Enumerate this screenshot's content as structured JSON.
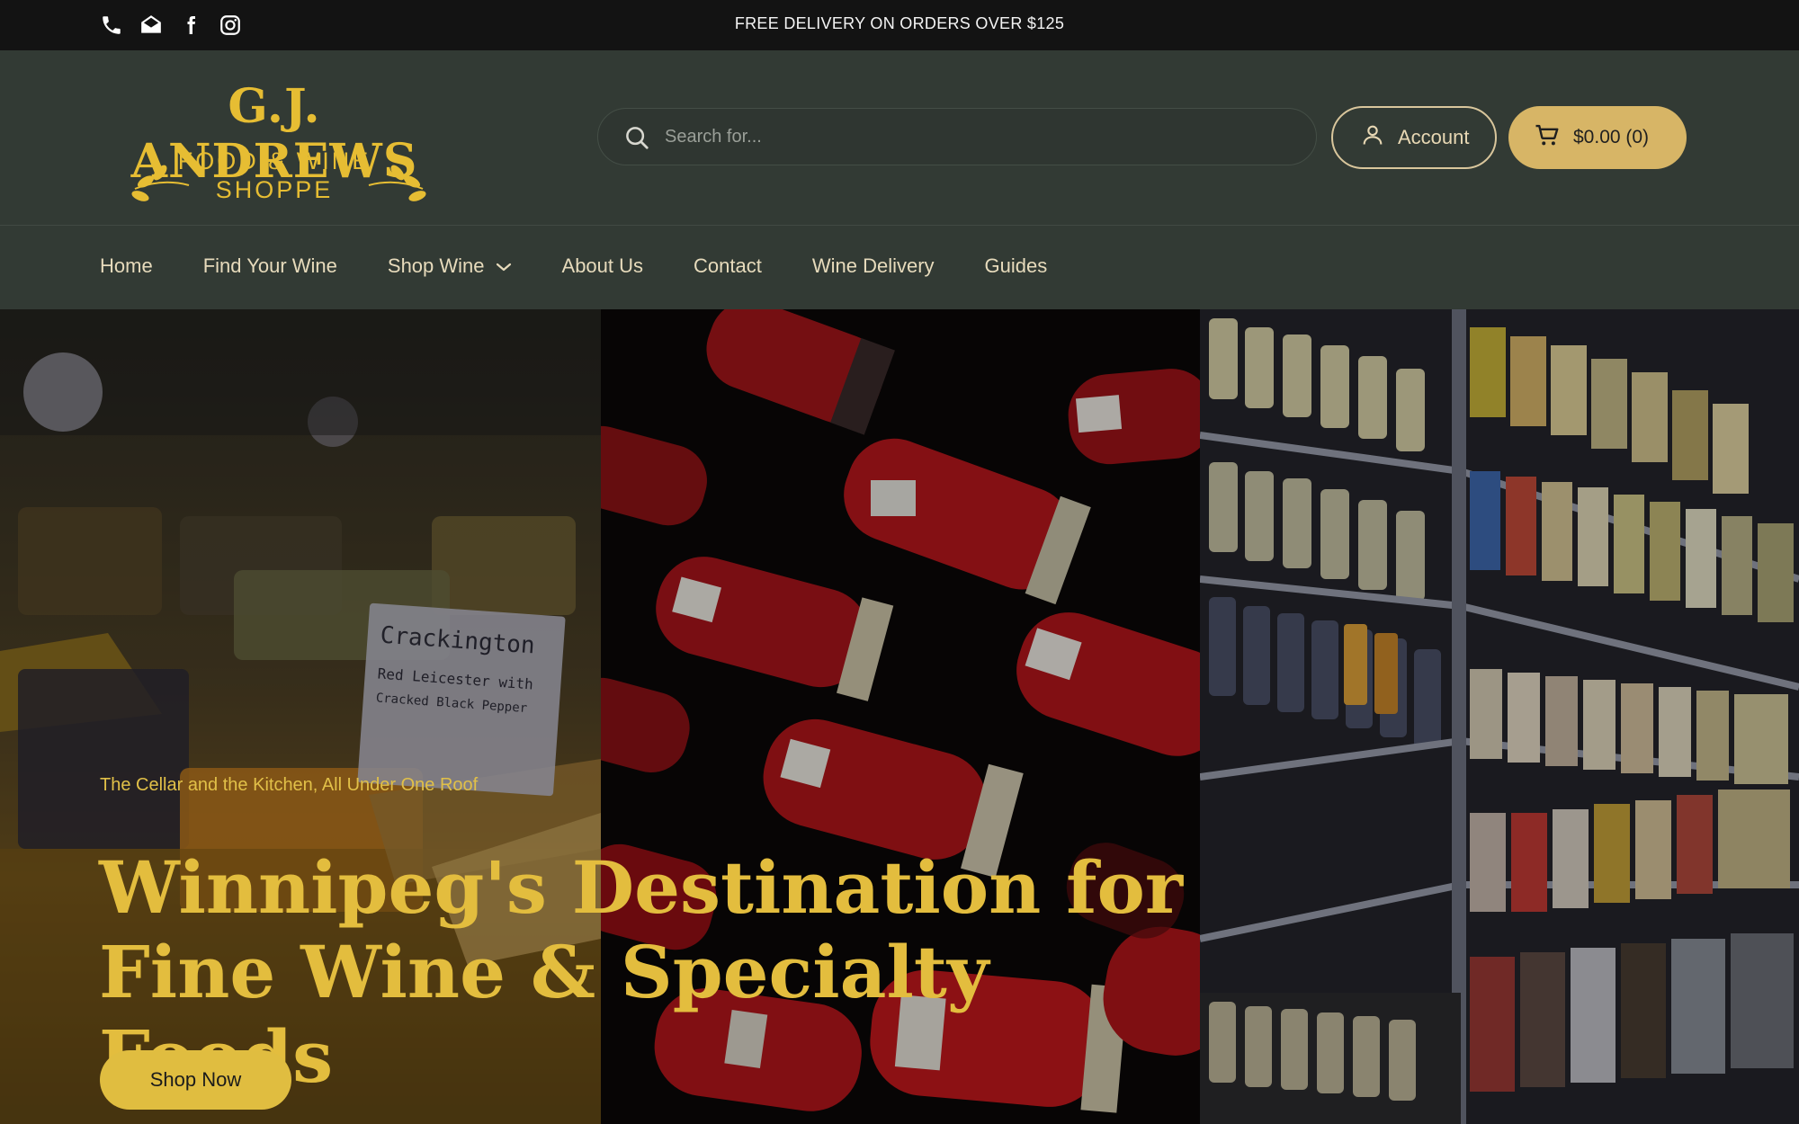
{
  "topbar": {
    "promo": "FREE DELIVERY ON ORDERS OVER $125",
    "social_icons": [
      "phone-icon",
      "email-icon",
      "facebook-icon",
      "instagram-icon"
    ]
  },
  "header": {
    "logo": {
      "brand": "G.J. ANDREWS",
      "line1": "FOOD & WINE",
      "line2": "SHOPPE"
    },
    "search": {
      "placeholder": "Search for..."
    },
    "account_label": "Account",
    "cart_label": "$0.00 (0)"
  },
  "nav": {
    "items": [
      {
        "label": "Home"
      },
      {
        "label": "Find Your Wine"
      },
      {
        "label": "Shop Wine"
      },
      {
        "label": "About Us"
      },
      {
        "label": "Contact"
      },
      {
        "label": "Wine Delivery"
      },
      {
        "label": "Guides"
      }
    ]
  },
  "hero": {
    "tagline": "The Cellar and the Kitchen, All Under One Roof",
    "headline": "Winnipeg's Destination for Fine Wine & Specialty Foods",
    "button_label": "Shop Now",
    "cheese_card": {
      "line1": "Crackington",
      "line2": "Red Leicester with",
      "line3": "Cracked Black Pepper"
    }
  },
  "colors": {
    "accent_gold": "#e0bd40",
    "header_bg": "#323a34",
    "topbar_bg": "#131313",
    "cart_button": "#d7b566"
  }
}
